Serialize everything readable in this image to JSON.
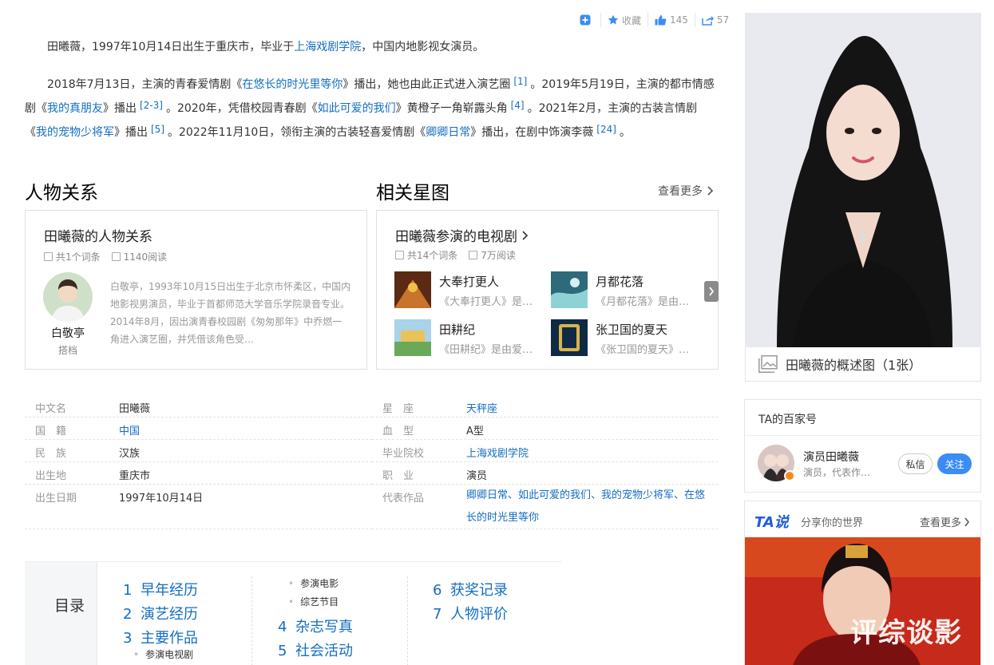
{
  "actions": {
    "add_icon": "plus-square-icon",
    "favorite_label": "收藏",
    "like_count": "145",
    "share_count": "57"
  },
  "intro": {
    "p1_a": "田曦薇，1997年10月14日出生于重庆市，毕业于",
    "p1_link": "上海戏剧学院",
    "p1_b": "，中国内地影视女演员。",
    "p2_a": "2018年7月13日，主演的青春爱情剧《",
    "p2_link1": "在悠长的时光里等你",
    "p2_b": "》播出，她也由此正式进入演艺圈",
    "p2_ref1": "[1]",
    "p2_c": "。2019年5月19日，主演的都市情感剧《",
    "p2_link2": "我的真朋友",
    "p2_d": "》播出",
    "p2_ref2": "[2-3]",
    "p2_e": "。2020年，凭借校园青春剧《",
    "p2_link3": "如此可爱的我们",
    "p2_f": "》黄橙子一角崭露头角",
    "p2_ref3": "[4]",
    "p2_g": "。2021年2月，主演的古装言情剧《",
    "p2_link4": "我的宠物少将军",
    "p2_h": "》播出",
    "p2_ref4": "[5]",
    "p2_i": "。2022年11月10日，领衔主演的古装轻喜爱情剧《",
    "p2_link5": "卿卿日常",
    "p2_j": "》播出，在剧中饰演李薇",
    "p2_ref5": "[24]",
    "p2_k": "。"
  },
  "relations": {
    "section_title": "人物关系",
    "card_title": "田曦薇的人物关系",
    "entries": "共1个词条",
    "reads": "1140阅读",
    "person_name": "白敬亭",
    "person_role": "搭档",
    "person_desc": "白敬亭，1993年10月15日出生于北京市怀柔区，中国内地影视男演员，毕业于首都师范大学音乐学院录音专业。2014年8月，因出演青春校园剧《匆匆那年》中乔燃一角进入演艺圈，并凭借该角色受…"
  },
  "stars": {
    "section_title": "相关星图",
    "more": "查看更多",
    "card_title": "田曦薇参演的电视剧",
    "entries": "共14个词条",
    "reads": "7万阅读",
    "shows": [
      {
        "name": "大奉打更人",
        "desc": "《大奉打更人》是…",
        "color": "#7a3b1c"
      },
      {
        "name": "月都花落",
        "desc": "《月都花落》是由…",
        "color": "#2d6a7a"
      },
      {
        "name": "田耕纪",
        "desc": "《田耕纪》是由爱…",
        "color": "#6aa85a"
      },
      {
        "name": "张卫国的夏天",
        "desc": "《张卫国的夏天》…",
        "color": "#0f2a44"
      }
    ]
  },
  "info": {
    "left": [
      {
        "label": "中文名",
        "value": "田曦薇",
        "link": false
      },
      {
        "label": "国　籍",
        "value": "中国",
        "link": true
      },
      {
        "label": "民　族",
        "value": "汉族",
        "link": false
      },
      {
        "label": "出生地",
        "value": "重庆市",
        "link": false
      },
      {
        "label": "出生日期",
        "value": "1997年10月14日",
        "link": false
      }
    ],
    "right": [
      {
        "label": "星　座",
        "value": "天秤座",
        "link": true
      },
      {
        "label": "血　型",
        "value": "A型",
        "link": false
      },
      {
        "label": "毕业院校",
        "value": "上海戏剧学院",
        "link": true
      },
      {
        "label": "职　业",
        "value": "演员",
        "link": false
      },
      {
        "label": "代表作品",
        "value": "卿卿日常、如此可爱的我们、我的宠物少将军、在悠长的时光里等你",
        "link": true
      }
    ]
  },
  "toc": {
    "label": "目录",
    "col1": [
      {
        "n": "1",
        "label": "早年经历"
      },
      {
        "n": "2",
        "label": "演艺经历"
      },
      {
        "n": "3",
        "label": "主要作品"
      }
    ],
    "col1_sub": "参演电视剧",
    "col2_sub": [
      "参演电影",
      "综艺节目"
    ],
    "col2": [
      {
        "n": "4",
        "label": "杂志写真"
      },
      {
        "n": "5",
        "label": "社会活动"
      }
    ],
    "col3": [
      {
        "n": "6",
        "label": "获奖记录"
      },
      {
        "n": "7",
        "label": "人物评价"
      }
    ]
  },
  "sidebar": {
    "photo_caption": "田曦薇的概述图（1张）",
    "bjh_title": "TA的百家号",
    "bjh_name": "演员田曦薇",
    "bjh_desc": "演员，代表作…",
    "msg_button": "私信",
    "follow_button": "关注",
    "tashuo_logo": "TA说",
    "tashuo_slogan": "分享你的世界",
    "tashuo_more": "查看更多",
    "watermark": "评综谈影"
  }
}
